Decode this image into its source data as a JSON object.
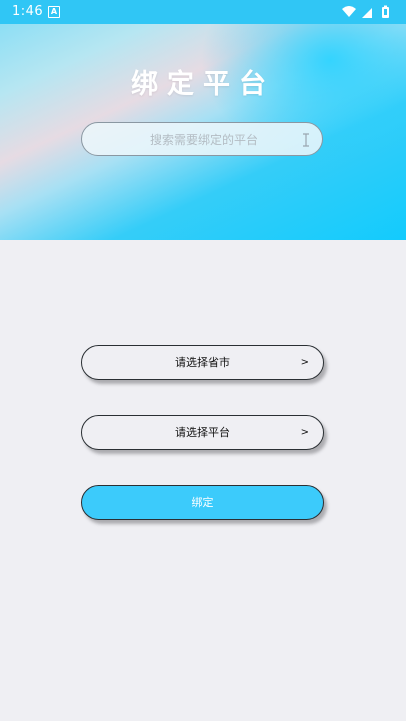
{
  "status_bar": {
    "time": "1:46",
    "app_icon_letter": "A",
    "icons": [
      "wifi-icon",
      "signal-icon",
      "battery-icon"
    ]
  },
  "header": {
    "title": "绑定平台"
  },
  "search": {
    "placeholder": "搜索需要绑定的平台",
    "value": ""
  },
  "selectors": {
    "province_city": {
      "label": "请选择省市",
      "chevron": ">"
    },
    "platform": {
      "label": "请选择平台",
      "chevron": ">"
    }
  },
  "actions": {
    "bind_label": "绑定"
  },
  "colors": {
    "accent": "#3ccbfb",
    "status_bar": "#30c6f5",
    "background": "#efeff3"
  }
}
